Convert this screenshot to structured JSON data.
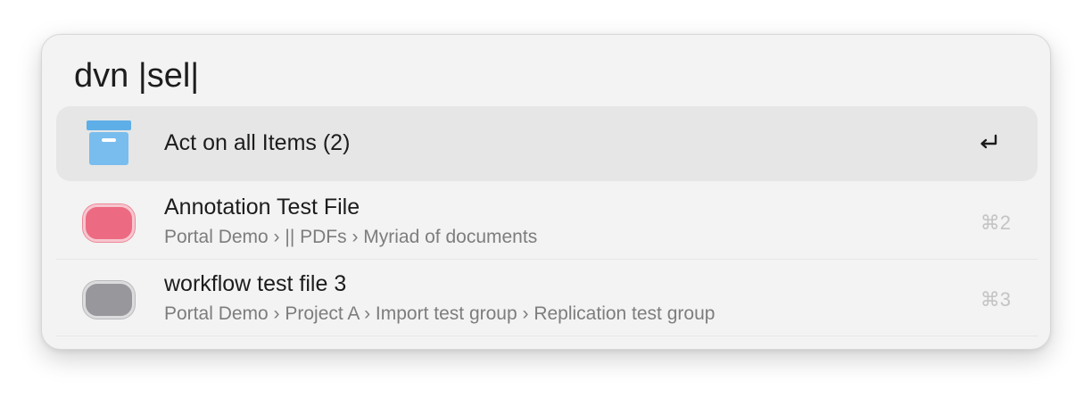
{
  "search": {
    "query": "dvn |sel|"
  },
  "results": [
    {
      "title": "Act on all Items (2)",
      "icon": "archive-box-icon",
      "shortcut": "↩",
      "selected": true,
      "color": "#6fb8ec"
    },
    {
      "title": "Annotation Test File",
      "subtitle": "Portal Demo › || PDFs › Myriad of documents",
      "icon": "pill-icon",
      "shortcut": "⌘2",
      "color": "#ec6b82"
    },
    {
      "title": "workflow test file 3",
      "subtitle": "Portal Demo › Project A › Import test group › Replication test group",
      "icon": "pill-icon",
      "shortcut": "⌘3",
      "color": "#98989c"
    }
  ]
}
